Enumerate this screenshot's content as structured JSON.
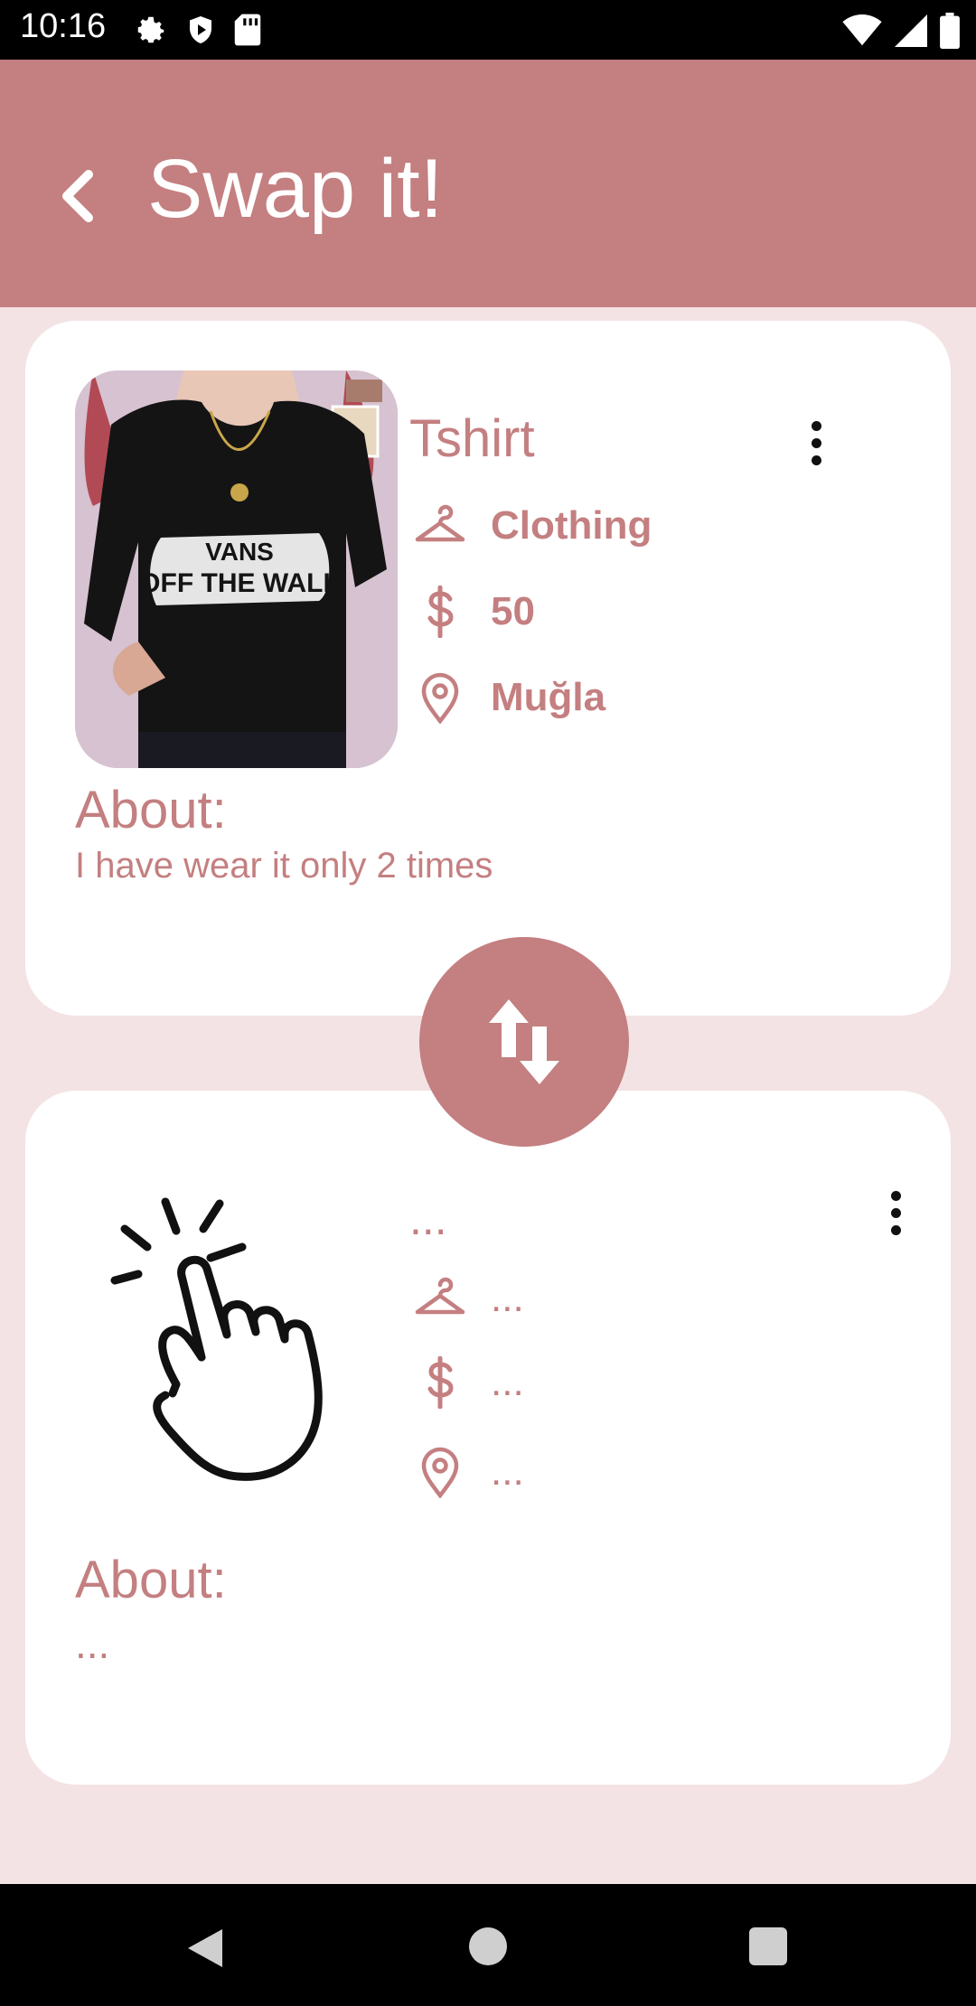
{
  "status_bar": {
    "time": "10:16",
    "icons_left": [
      "gear-icon",
      "shield-icon",
      "sdcard-icon"
    ],
    "icons_right": [
      "wifi-icon",
      "signal-icon",
      "battery-icon"
    ]
  },
  "app_bar": {
    "title": "Swap it!",
    "back_icon": "chevron-left-icon",
    "color": "#c47f80"
  },
  "item_top": {
    "name": "Tshirt",
    "category": "Clothing",
    "price": "50",
    "location": "Muğla",
    "about_label": "About:",
    "about_text": "I have wear it only 2 times",
    "image_text_line1": "VANS",
    "image_text_line2": "OFF THE WALL"
  },
  "item_bottom": {
    "name": "...",
    "category": "...",
    "price": "...",
    "location": "...",
    "about_label": "About:",
    "about_text": "..."
  },
  "icons": {
    "category": "hanger-icon",
    "price": "dollar-icon",
    "location": "location-pin-icon",
    "more": "more-vert-icon",
    "swap": "swap-vertical-icon",
    "select": "tap-hand-icon"
  },
  "colors": {
    "accent": "#c47f80",
    "background": "#f4e3e4",
    "card": "#ffffff"
  }
}
